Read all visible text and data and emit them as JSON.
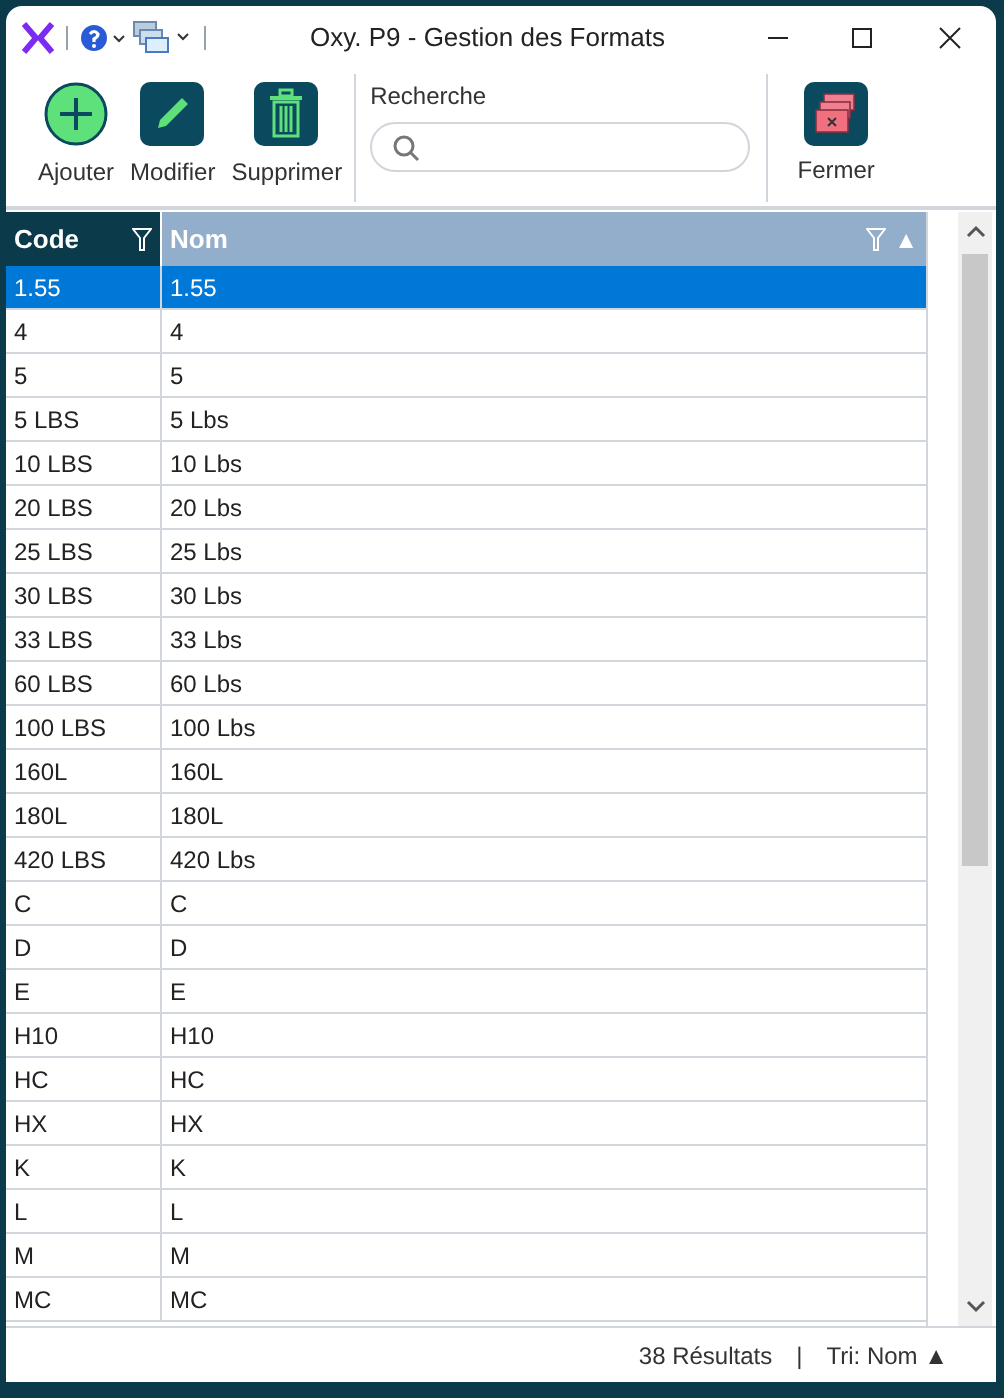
{
  "window": {
    "title": "Oxy. P9 - Gestion des Formats"
  },
  "toolbar": {
    "buttons": [
      {
        "kind": "add",
        "label": "Ajouter"
      },
      {
        "kind": "edit",
        "label": "Modifier"
      },
      {
        "kind": "delete",
        "label": "Supprimer"
      }
    ],
    "search": {
      "label": "Recherche"
    },
    "close": {
      "label": "Fermer"
    }
  },
  "table": {
    "columns": [
      {
        "label": "Code",
        "selected": false
      },
      {
        "label": "Nom",
        "selected": true,
        "sort": "▲"
      }
    ],
    "rows": [
      {
        "code": "1.55",
        "nom": "1.55",
        "selected": true
      },
      {
        "code": "4",
        "nom": "4",
        "selected": false
      },
      {
        "code": "5",
        "nom": "5",
        "selected": false
      },
      {
        "code": "5 LBS",
        "nom": "5 Lbs",
        "selected": false
      },
      {
        "code": "10 LBS",
        "nom": "10 Lbs",
        "selected": false
      },
      {
        "code": "20 LBS",
        "nom": "20 Lbs",
        "selected": false
      },
      {
        "code": "25 LBS",
        "nom": "25 Lbs",
        "selected": false
      },
      {
        "code": "30 LBS",
        "nom": "30 Lbs",
        "selected": false
      },
      {
        "code": "33 LBS",
        "nom": "33 Lbs",
        "selected": false
      },
      {
        "code": "60 LBS",
        "nom": "60 Lbs",
        "selected": false
      },
      {
        "code": "100 LBS",
        "nom": "100 Lbs",
        "selected": false
      },
      {
        "code": "160L",
        "nom": "160L",
        "selected": false
      },
      {
        "code": "180L",
        "nom": "180L",
        "selected": false
      },
      {
        "code": "420 LBS",
        "nom": "420 Lbs",
        "selected": false
      },
      {
        "code": "C",
        "nom": "C",
        "selected": false
      },
      {
        "code": "D",
        "nom": "D",
        "selected": false
      },
      {
        "code": "E",
        "nom": "E",
        "selected": false
      },
      {
        "code": "H10",
        "nom": "H10",
        "selected": false
      },
      {
        "code": "HC",
        "nom": "HC",
        "selected": false
      },
      {
        "code": "HX",
        "nom": "HX",
        "selected": false
      },
      {
        "code": "K",
        "nom": "K",
        "selected": false
      },
      {
        "code": "L",
        "nom": "L",
        "selected": false
      },
      {
        "code": "M",
        "nom": "M",
        "selected": false
      },
      {
        "code": "MC",
        "nom": "MC",
        "selected": false
      }
    ]
  },
  "status_bar": {
    "count": "38 Résultats",
    "separator": "|",
    "sort": "Tri: Nom ▲"
  }
}
